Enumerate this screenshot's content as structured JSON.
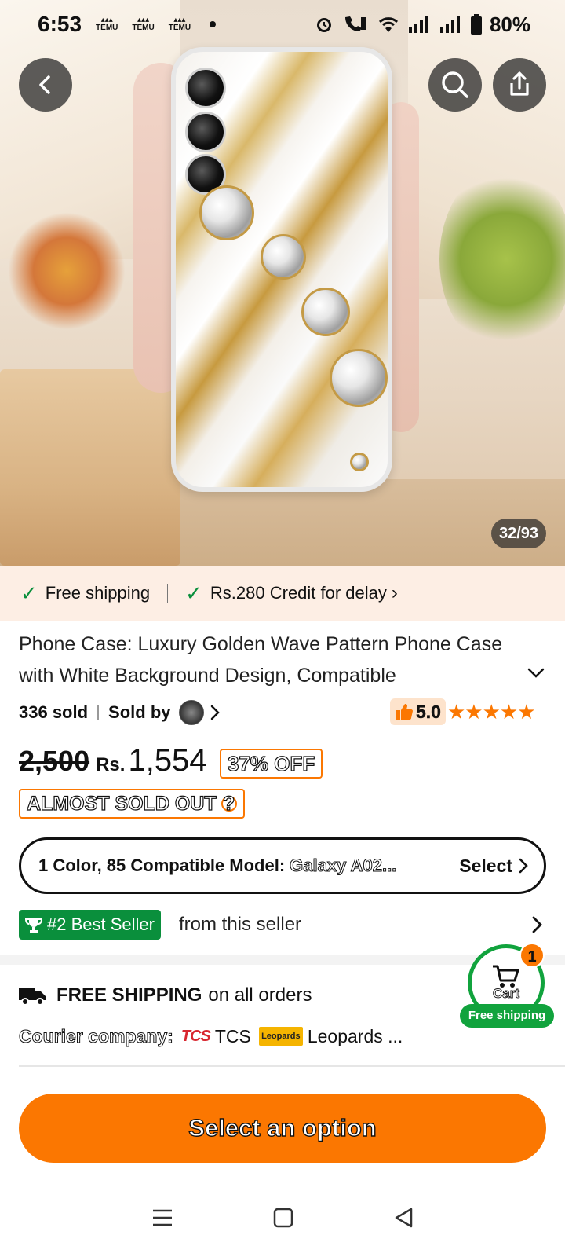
{
  "status_bar": {
    "time": "6:53",
    "notification_icons": [
      "TEMU",
      "TEMU",
      "TEMU"
    ],
    "icons": [
      "alarm-icon",
      "wifi-call-icon",
      "wifi-icon",
      "signal-icon",
      "signal-icon",
      "battery-icon"
    ],
    "battery": "80%"
  },
  "gallery": {
    "counter": "32/93"
  },
  "shipping_banner": {
    "free_shipping": "Free shipping",
    "credit": "Rs.280 Credit for delay",
    "chevron": "›"
  },
  "product": {
    "title": "Phone Case: Luxury Golden Wave Pattern Phone Case with White Background Design, Compatible",
    "sold": "336 sold",
    "sold_by": "Sold by",
    "rating": "5.0",
    "stars": "★★★★★",
    "old_price": "2,500",
    "currency": "Rs.",
    "price": "1,554",
    "discount": "37% OFF",
    "stock_badge": "ALMOST SOLD OUT",
    "stock_help": "?"
  },
  "options": {
    "label": "1 Color, 85 Compatible Model:",
    "model": "Galaxy A02...",
    "select": "Select"
  },
  "best_seller": {
    "badge": "#2 Best Seller",
    "suffix": "from this seller"
  },
  "shipping": {
    "title_bold": "FREE SHIPPING",
    "title_rest": "on all orders",
    "courier_label": "Courier company:",
    "tcs_logo": "TCS",
    "tcs": "TCS",
    "leopards_logo": "Leopards",
    "leopards": "Leopards ..."
  },
  "cart": {
    "count": "1",
    "label": "Cart",
    "free_shipping": "Free shipping"
  },
  "cta": {
    "label": "Select an option"
  },
  "colors": {
    "accent": "#fb7701",
    "green": "#0a8f3c",
    "banner_bg": "#fdeee4"
  }
}
